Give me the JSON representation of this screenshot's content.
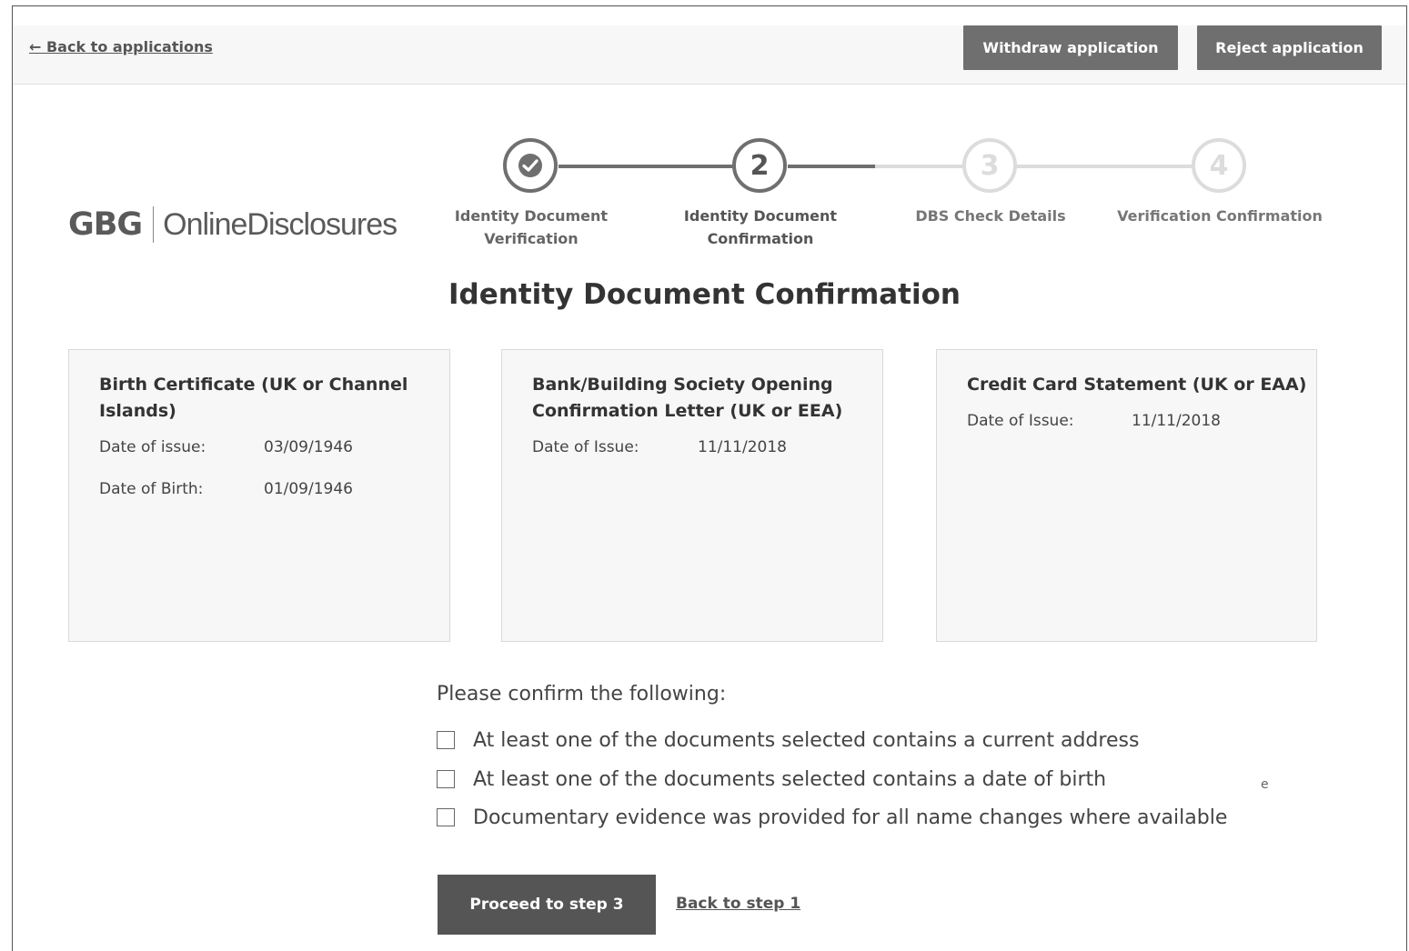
{
  "header": {
    "back_link": "← Back to applications",
    "withdraw_label": "Withdraw application",
    "reject_label": "Reject application"
  },
  "logo": {
    "brand": "GBG",
    "product": "OnlineDisclosures"
  },
  "stepper": {
    "steps": [
      {
        "number": "✔",
        "label_line1": "Identity Document",
        "label_line2": "Verification",
        "state": "complete"
      },
      {
        "number": "2",
        "label_line1": "Identity Document",
        "label_line2": "Confirmation",
        "state": "current"
      },
      {
        "number": "3",
        "label_line1": "DBS Check Details",
        "label_line2": "",
        "state": "upcoming"
      },
      {
        "number": "4",
        "label_line1": "Verification Confirmation",
        "label_line2": "",
        "state": "upcoming"
      }
    ],
    "colors": {
      "active": "#6f6f6f",
      "inactive": "#dcdcdc"
    }
  },
  "page": {
    "title": "Identity Document Confirmation"
  },
  "documents": [
    {
      "title": "Birth Certificate (UK or Channel Islands)",
      "fields": [
        {
          "label": "Date of issue:",
          "value": "03/09/1946"
        },
        {
          "label": "Date of Birth:",
          "value": "01/09/1946"
        }
      ]
    },
    {
      "title": "Bank/Building Society Opening Confirmation Letter (UK or EEA)",
      "fields": [
        {
          "label": "Date of Issue:",
          "value": "11/11/2018"
        }
      ]
    },
    {
      "title": "Credit Card Statement (UK or EAA)",
      "fields": [
        {
          "label": "Date of Issue:",
          "value": "11/11/2018"
        }
      ]
    }
  ],
  "confirm": {
    "heading": "Please confirm the following:",
    "items": [
      {
        "label": "At least one of the documents selected contains a current address",
        "checked": false
      },
      {
        "label": "At least one of the documents selected contains a date of birth",
        "checked": false
      },
      {
        "label": "Documentary evidence was provided for all name changes where available",
        "checked": false
      }
    ],
    "stray_glyph": "e"
  },
  "actions": {
    "proceed_label": "Proceed to step 3",
    "back_label": "Back to step 1"
  }
}
